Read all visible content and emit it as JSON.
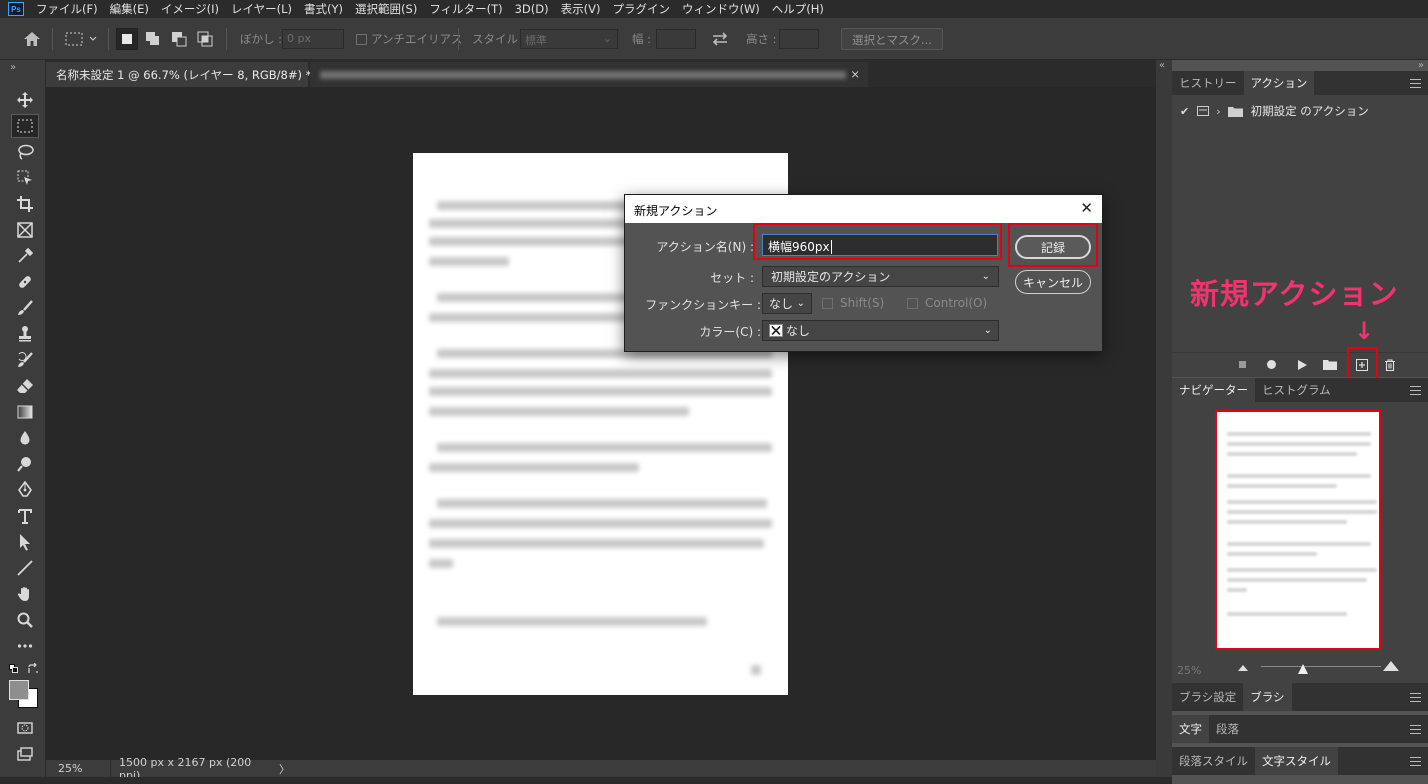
{
  "app": {
    "logo": "Ps"
  },
  "menubar": [
    "ファイル(F)",
    "編集(E)",
    "イメージ(I)",
    "レイヤー(L)",
    "書式(Y)",
    "選択範囲(S)",
    "フィルター(T)",
    "3D(D)",
    "表示(V)",
    "プラグイン",
    "ウィンドウ(W)",
    "ヘルプ(H)"
  ],
  "options": {
    "feather_label": "ぼかし :",
    "feather_value": "0 px",
    "antialias": "アンチエイリアス",
    "style_label": "スタイル :",
    "style_value": "標準",
    "width_label": "幅 :",
    "height_label": "高さ :",
    "select_mask": "選択とマスク..."
  },
  "tabs": [
    {
      "label": "名称未設定 1 @ 66.7% (レイヤー 8, RGB/8#) *",
      "close": "×"
    },
    {
      "label": "",
      "close": "×"
    }
  ],
  "status": {
    "zoom": "25%",
    "size": "1500 px x 2167 px (200 ppi)",
    "arrow": "〉"
  },
  "dialog": {
    "title": "新規アクション",
    "close": "✕",
    "name_label": "アクション名(N) :",
    "name_value": "横幅960px",
    "set_label": "セット :",
    "set_value": "初期設定のアクション",
    "fkey_label": "ファンクションキー :",
    "fkey_value": "なし",
    "shift": "Shift(S)",
    "control": "Control(O)",
    "color_label": "カラー(C) :",
    "color_value": "なし",
    "record": "記録",
    "cancel": "キャンセル"
  },
  "panels": {
    "history_tab": "ヒストリー",
    "actions_tab": "アクション",
    "action_item": "初期設定 のアクション",
    "navigator_tab": "ナビゲーター",
    "histogram_tab": "ヒストグラム",
    "nav_zoom": "25%",
    "brush_settings_tab": "ブラシ設定",
    "brush_tab": "ブラシ",
    "char_tab": "文字",
    "para_tab": "段落",
    "para_style_tab": "段落スタイル",
    "char_style_tab": "文字スタイル"
  },
  "annotation": {
    "label": "新規アクション",
    "arrow": "↓"
  },
  "colors": {
    "annotation": "#f0346e",
    "highlight": "#e60012",
    "accent": "#31a8ff"
  }
}
